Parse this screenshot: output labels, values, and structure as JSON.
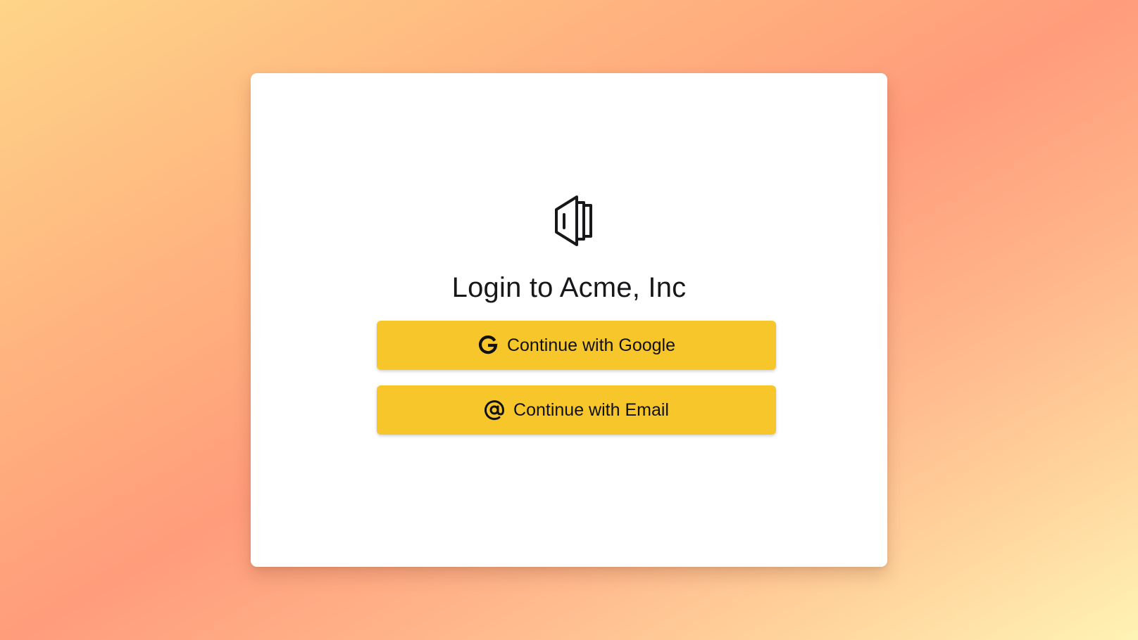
{
  "login": {
    "logo_icon": "stacked-panels-logo-icon",
    "title": "Login to Acme, Inc",
    "buttons": [
      {
        "icon": "google-icon",
        "label": "Continue with Google"
      },
      {
        "icon": "at-sign-icon",
        "label": "Continue with Email"
      }
    ]
  },
  "colors": {
    "button_bg": "#f6c62b",
    "card_bg": "#ffffff",
    "text": "#18181b"
  }
}
